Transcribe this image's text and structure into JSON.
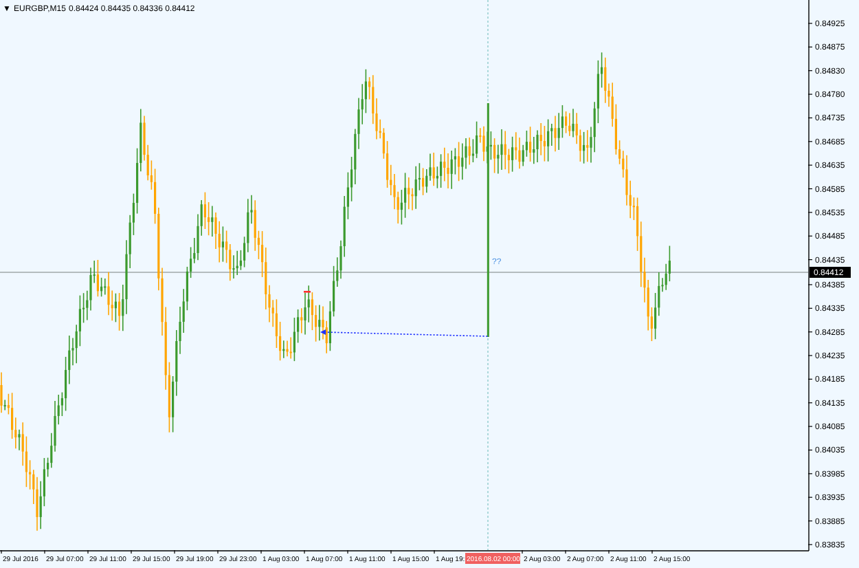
{
  "header": {
    "menu_glyph": "▼",
    "symbol": "EURGBP,M15",
    "quotes": "0.84424 0.84435 0.84336 0.84412"
  },
  "price_axis": [
    {
      "text": "0.84925",
      "kind": "tick"
    },
    {
      "text": "0.84875",
      "kind": "tick"
    },
    {
      "text": "0.84830",
      "kind": "tick"
    },
    {
      "text": "0.84780",
      "kind": "tick"
    },
    {
      "text": "0.84735",
      "kind": "tick"
    },
    {
      "text": "0.84685",
      "kind": "tick"
    },
    {
      "text": "0.84635",
      "kind": "tick"
    },
    {
      "text": "0.84585",
      "kind": "tick"
    },
    {
      "text": "0.84535",
      "kind": "tick"
    },
    {
      "text": "0.84485",
      "kind": "tick"
    },
    {
      "text": "0.84435",
      "kind": "tick"
    },
    {
      "text": "0.84412",
      "kind": "current"
    },
    {
      "text": "0.84385",
      "kind": "tick"
    },
    {
      "text": "0.84335",
      "kind": "tick"
    },
    {
      "text": "0.84285",
      "kind": "tick"
    },
    {
      "text": "0.84235",
      "kind": "tick"
    },
    {
      "text": "0.84185",
      "kind": "tick"
    },
    {
      "text": "0.84135",
      "kind": "tick"
    },
    {
      "text": "0.84085",
      "kind": "tick"
    },
    {
      "text": "0.84035",
      "kind": "tick"
    },
    {
      "text": "0.83985",
      "kind": "tick"
    },
    {
      "text": "0.83935",
      "kind": "tick"
    },
    {
      "text": "0.83885",
      "kind": "tick"
    },
    {
      "text": "0.83835",
      "kind": "tick"
    }
  ],
  "time_axis": [
    {
      "text": "29 Jul 2016",
      "kind": "tick"
    },
    {
      "text": "29 Jul 07:00",
      "kind": "tick"
    },
    {
      "text": "29 Jul 11:00",
      "kind": "tick"
    },
    {
      "text": "29 Jul 15:00",
      "kind": "tick"
    },
    {
      "text": "29 Jul 19:00",
      "kind": "tick"
    },
    {
      "text": "29 Jul 23:00",
      "kind": "tick"
    },
    {
      "text": "1 Aug 03:00",
      "kind": "tick"
    },
    {
      "text": "1 Aug 07:00",
      "kind": "tick"
    },
    {
      "text": "1 Aug 11:00",
      "kind": "tick"
    },
    {
      "text": "1 Aug 15:00",
      "kind": "tick"
    },
    {
      "text": "1 Aug 19:",
      "kind": "tick"
    },
    {
      "text": "2016.08.02 00:00",
      "kind": "cursor"
    },
    {
      "text": "2 Aug 03:00",
      "kind": "tick"
    },
    {
      "text": "2 Aug 07:00",
      "kind": "tick"
    },
    {
      "text": "2 Aug 11:00",
      "kind": "tick"
    },
    {
      "text": "2 Aug 15:00",
      "kind": "tick"
    }
  ],
  "crosshair_label": "??"
}
